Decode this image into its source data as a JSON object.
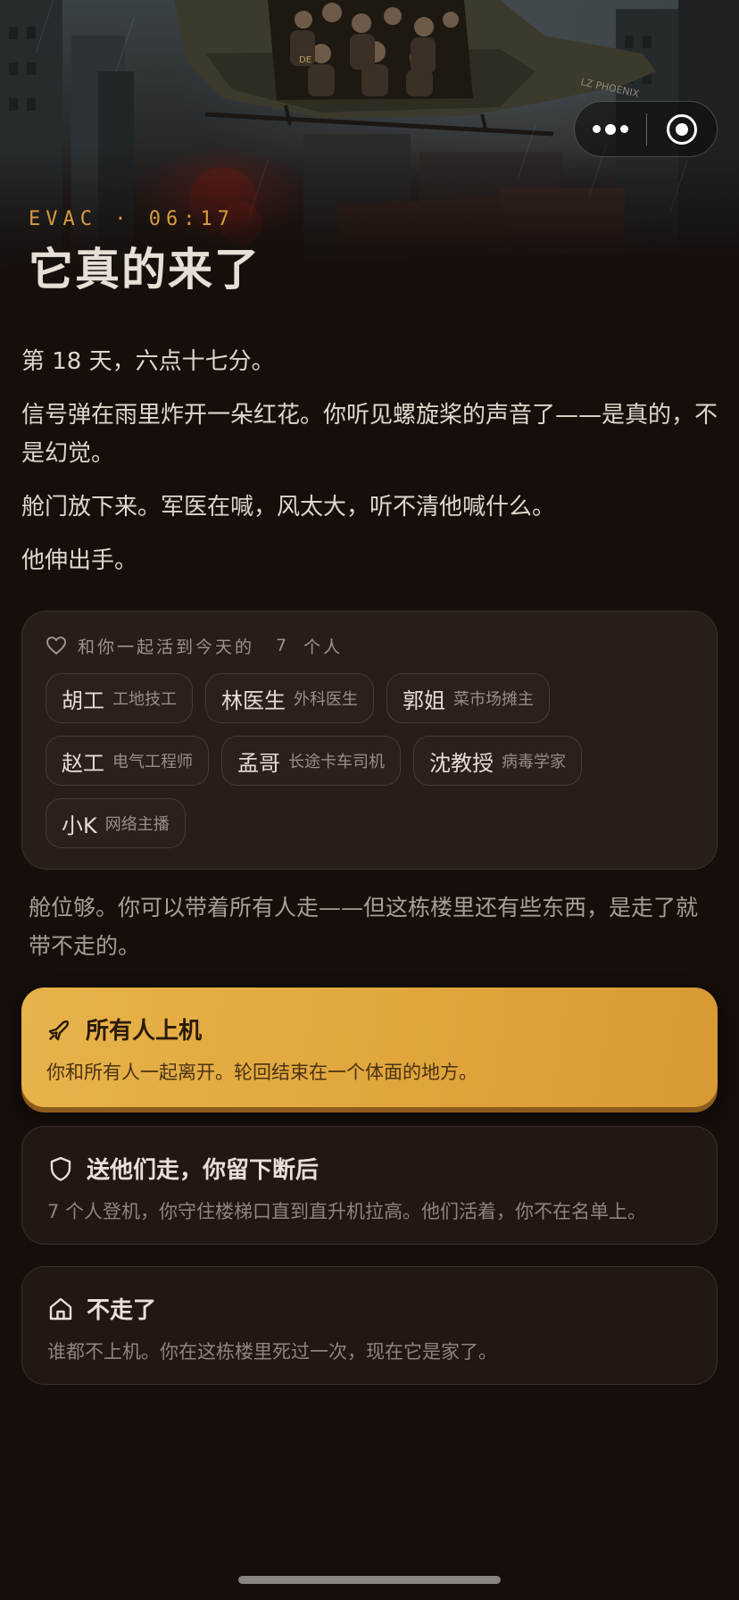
{
  "header": {
    "eyebrow": "EVAC · 06:17",
    "title": "它真的来了",
    "heli_markings": {
      "door": "DE",
      "tail": "LZ PHOENIX"
    }
  },
  "capsule": {
    "more_icon": "more-dots-icon",
    "close_icon": "target-close-icon"
  },
  "story": [
    "第 18 天，六点十七分。",
    "信号弹在雨里炸开一朵红花。你听见螺旋桨的声音了——是真的，不是幻觉。",
    "舱门放下来。军医在喊，风太大，听不清他喊什么。",
    "他伸出手。"
  ],
  "survivors": {
    "icon": "heart-icon",
    "prefix": "和你一起活到今天的",
    "count": "7",
    "suffix": "个人",
    "people": [
      {
        "name": "胡工",
        "role": "工地技工"
      },
      {
        "name": "林医生",
        "role": "外科医生"
      },
      {
        "name": "郭姐",
        "role": "菜市场摊主"
      },
      {
        "name": "赵工",
        "role": "电气工程师"
      },
      {
        "name": "孟哥",
        "role": "长途卡车司机"
      },
      {
        "name": "沈教授",
        "role": "病毒学家"
      },
      {
        "name": "小K",
        "role": "网络主播"
      }
    ]
  },
  "prompt": "舱位够。你可以带着所有人走——但这栋楼里还有些东西，是走了就带不走的。",
  "choices": [
    {
      "icon": "plane-icon",
      "label": "所有人上机",
      "desc": "你和所有人一起离开。轮回结束在一个体面的地方。"
    },
    {
      "icon": "shield-icon",
      "label": "送他们走，你留下断后",
      "desc": "7 个人登机，你守住楼梯口直到直升机拉高。他们活着，你不在名单上。"
    },
    {
      "icon": "home-icon",
      "label": "不走了",
      "desc": "谁都不上机。你在这栋楼里死过一次，现在它是家了。"
    }
  ],
  "colors": {
    "accent": "#d89c3e",
    "primary_choice": "#e1a73d",
    "background": "#150e0b"
  }
}
